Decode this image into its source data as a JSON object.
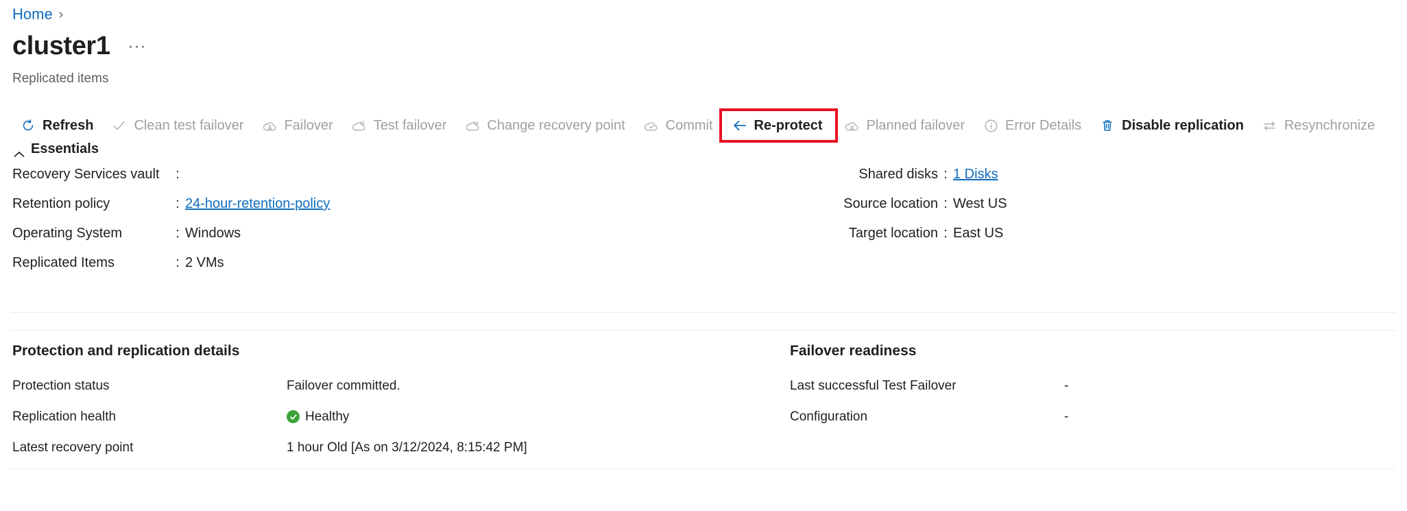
{
  "breadcrumb": {
    "home": "Home",
    "separator": "›"
  },
  "header": {
    "title": "cluster1",
    "subtitle": "Replicated items",
    "more_label": "···"
  },
  "toolbar": {
    "items": [
      {
        "label": "Refresh",
        "icon": "refresh-icon",
        "enabled": true
      },
      {
        "label": "Clean test failover",
        "icon": "checkmark-icon",
        "enabled": false
      },
      {
        "label": "Failover",
        "icon": "cloud-failover-icon",
        "enabled": false
      },
      {
        "label": "Test failover",
        "icon": "cloud-test-failover-icon",
        "enabled": false
      },
      {
        "label": "Change recovery point",
        "icon": "cloud-recovery-icon",
        "enabled": false
      },
      {
        "label": "Commit",
        "icon": "cloud-check-icon",
        "enabled": false
      },
      {
        "label": "Re-protect",
        "icon": "arrow-left-icon",
        "enabled": true,
        "highlighted": true
      },
      {
        "label": "Planned failover",
        "icon": "cloud-planned-icon",
        "enabled": false
      },
      {
        "label": "Error Details",
        "icon": "info-circle-icon",
        "enabled": false
      },
      {
        "label": "Disable replication",
        "icon": "trash-icon",
        "enabled": true
      },
      {
        "label": "Resynchronize",
        "icon": "sync-arrows-icon",
        "enabled": false
      }
    ]
  },
  "essentials": {
    "toggle_label": "Essentials",
    "left": [
      {
        "label": "Recovery Services vault",
        "value": "",
        "link": false
      },
      {
        "label": "Retention policy",
        "value": "24-hour-retention-policy",
        "link": true
      },
      {
        "label": "Operating System",
        "value": "Windows",
        "link": false
      },
      {
        "label": "Replicated Items",
        "value": "2 VMs",
        "link": false
      }
    ],
    "right": [
      {
        "label": "Shared disks",
        "value": "1 Disks",
        "link": true
      },
      {
        "label": "Source location",
        "value": "West US",
        "link": false
      },
      {
        "label": "Target location",
        "value": "East US",
        "link": false
      }
    ]
  },
  "protection": {
    "title": "Protection and replication details",
    "rows": [
      {
        "label": "Protection status",
        "value": "Failover committed.",
        "status": false
      },
      {
        "label": "Replication health",
        "value": "Healthy",
        "status": true
      },
      {
        "label": "Latest recovery point",
        "value": "1 hour Old [As on 3/12/2024, 8:15:42 PM]",
        "status": false
      }
    ]
  },
  "failover_readiness": {
    "title": "Failover readiness",
    "rows": [
      {
        "label": "Last successful Test Failover",
        "value": "-"
      },
      {
        "label": "Configuration",
        "value": "-"
      }
    ]
  },
  "colors": {
    "link": "#0f6cbd",
    "accent": "#0f6cbd",
    "highlight_box": "#e81123",
    "healthy_green": "#3aa33a",
    "disabled_text": "#a19f9d",
    "text": "#201f1e",
    "subtle_text": "#605e5c",
    "divider": "#edebe9"
  }
}
